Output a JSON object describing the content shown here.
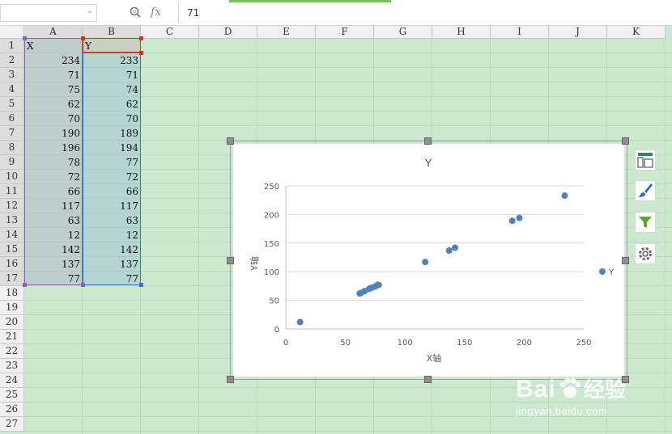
{
  "formula_bar": {
    "name_box": "",
    "fx_label": "fx",
    "formula_value": "71"
  },
  "columns": [
    "A",
    "B",
    "C",
    "D",
    "E",
    "F",
    "G",
    "H",
    "I",
    "J",
    "K"
  ],
  "rows": [
    "1",
    "2",
    "3",
    "4",
    "5",
    "6",
    "7",
    "8",
    "9",
    "10",
    "11",
    "12",
    "13",
    "14",
    "15",
    "16",
    "17",
    "18",
    "19",
    "20",
    "21",
    "22",
    "23",
    "24",
    "25",
    "26",
    "27"
  ],
  "sheet": {
    "header_x": "X",
    "header_y": "Y",
    "x_values": [
      "234",
      "71",
      "75",
      "62",
      "70",
      "190",
      "196",
      "78",
      "72",
      "66",
      "117",
      "63",
      "12",
      "142",
      "137",
      "77"
    ],
    "y_values": [
      "233",
      "71",
      "74",
      "62",
      "70",
      "189",
      "194",
      "77",
      "72",
      "66",
      "117",
      "63",
      "12",
      "142",
      "137",
      "77"
    ]
  },
  "chart_data": {
    "type": "scatter",
    "title": "Y",
    "xlabel": "X轴",
    "ylabel": "Y轴",
    "xlim": [
      0,
      250
    ],
    "ylim": [
      0,
      250
    ],
    "x_ticks": [
      "0",
      "50",
      "100",
      "150",
      "200",
      "250"
    ],
    "y_ticks": [
      "0",
      "50",
      "100",
      "150",
      "200",
      "250"
    ],
    "series": [
      {
        "name": "Y",
        "x": [
          234,
          71,
          75,
          62,
          70,
          190,
          196,
          78,
          72,
          66,
          117,
          63,
          12,
          142,
          137,
          77
        ],
        "y": [
          233,
          71,
          74,
          62,
          70,
          189,
          194,
          77,
          72,
          66,
          117,
          63,
          12,
          142,
          137,
          77
        ],
        "color": "#4f81bd"
      }
    ],
    "legend_position": "right",
    "grid": true
  },
  "side_buttons": [
    "chart-elements-icon",
    "chart-styles-icon",
    "chart-filter-icon",
    "chart-settings-icon"
  ],
  "watermark": {
    "brand_left": "Bai",
    "brand_right": "经验",
    "url": "jingyan.baidu.com"
  },
  "colors": {
    "accent": "#4f81bd",
    "sheet_bg": "#cce8cf",
    "selection_x": "#7b4fa0",
    "selection_y": "#c0392b"
  }
}
